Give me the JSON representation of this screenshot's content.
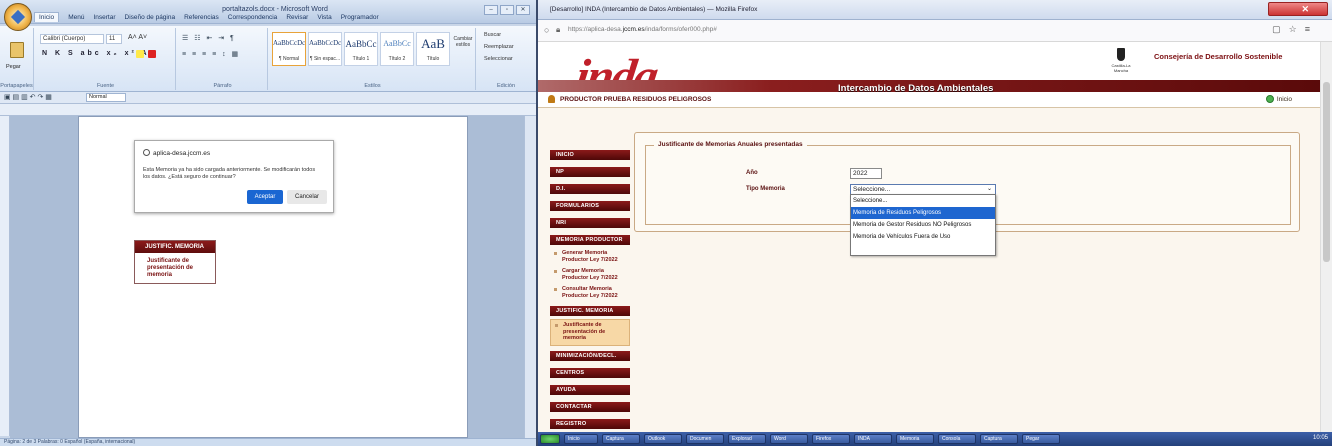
{
  "word": {
    "title": "portaltazols.docx - Microsoft Word",
    "tabs": [
      "Inicio",
      "Menú",
      "Insertar",
      "Diseño de página",
      "Referencias",
      "Correspondencia",
      "Revisar",
      "Vista",
      "Programador"
    ],
    "ribbon": {
      "clipboard_label": "Portapapeles",
      "paste_label": "Pegar",
      "font_name": "Calibri (Cuerpo)",
      "font_size": "11",
      "font_group": "Fuente",
      "paragraph_group": "Párrafo",
      "styles_group": "Estilos",
      "editing_group": "Edición",
      "styles": [
        {
          "sample": "AaBbCcDc",
          "name": "¶ Normal"
        },
        {
          "sample": "AaBbCcDc",
          "name": "¶ Sin espac..."
        },
        {
          "sample": "AaBbCc",
          "name": "Título 1"
        },
        {
          "sample": "AaBbCc",
          "name": "Título 2"
        },
        {
          "sample": "AaB",
          "name": "Título"
        }
      ],
      "change_styles": "Cambiar estilos",
      "find": "Buscar",
      "replace": "Reemplazar",
      "select": "Seleccionar"
    },
    "qat_style": "Normal",
    "status": "Página: 2 de 3   Palabras: 0   Español (España, internacional)"
  },
  "dialog": {
    "origin": "aplica-desa.jccm.es",
    "message": "Esta Memoria ya ha sido cargada anteriormente. Se modificarán todos los datos. ¿Está seguro de continuar?",
    "ok": "Aceptar",
    "cancel": "Cancelar"
  },
  "word_panel": {
    "header": "JUSTIFIC. MEMORIA",
    "link": "Justificante de presentación de memoria"
  },
  "firefox": {
    "title": "[Desarrollo] INDA (Intercambio de Datos Ambientales) — Mozilla Firefox",
    "url_prefix": "https://aplica-desa.",
    "url_domain": "jccm.es",
    "url_path": "/inda/forms/ofer000.php#"
  },
  "site": {
    "logo": "inda",
    "region": "Castilla-La Mancha",
    "consejeria": "Consejería de Desarrollo Sostenible",
    "app_title": "Intercambio de Datos Ambientales",
    "producer": "PRODUCTOR PRUEBA RESIDUOS PELIGROSOS",
    "home": "Inicio"
  },
  "menu": {
    "items": [
      "INICIO",
      "NP",
      "D.I.",
      "FORMULARIOS",
      "NRI",
      "MEMORIA PRODUCTOR"
    ],
    "memoria_sub": [
      "Generar Memoria Productor Ley 7/2022",
      "Cargar Memoria Productor Ley 7/2022",
      "Consultar Memoria Productor Ley 7/2022"
    ],
    "justific": "JUSTIFIC. MEMORIA",
    "justific_sub": "Justificante de presentación de memoria",
    "items2": [
      "MINIMIZACIÓN/DECL.",
      "CENTROS",
      "AYUDA",
      "CONTACTAR",
      "REGISTRO"
    ]
  },
  "form": {
    "legend": "Justificante de Memorias Anuales presentadas",
    "year_label": "Año",
    "year_value": "2022",
    "type_label": "Tipo Memoria",
    "type_value": "Seleccione...",
    "options": [
      "Seleccione...",
      "Memoria de Residuos Peligrosos",
      "Memoria de Gestor Residuos NO Peligrosos",
      "Memoria de Vehículos Fuera de Uso"
    ],
    "highlighted_option": 1
  },
  "taskbar": {
    "buttons": [
      "Inicio",
      "Captura",
      "Outlook",
      "Documen",
      "Explorad",
      "Word",
      "Firefox",
      "INDA",
      "Memoria",
      "Consola",
      "Captura",
      "Pegar"
    ],
    "clock": "10:05"
  },
  "colors": {
    "brand_red": "#7c0f12",
    "select_blue": "#1e66d0",
    "button_blue": "#1a66d2"
  }
}
